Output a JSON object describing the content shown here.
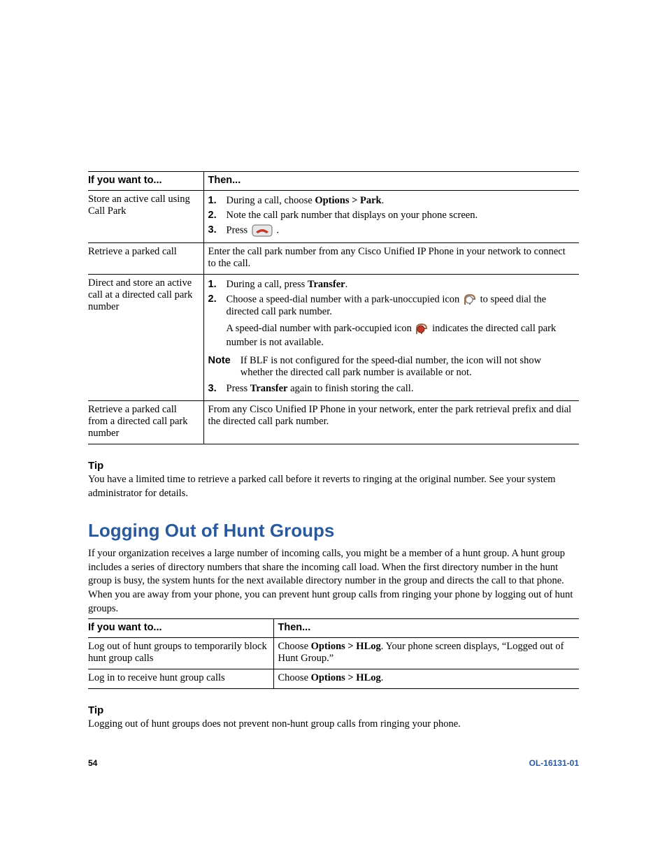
{
  "table1": {
    "head": {
      "c1": "If you want to...",
      "c2": "Then..."
    },
    "rows": [
      {
        "c1": "Store an active call using Call Park",
        "steps": [
          {
            "n": "1.",
            "pre": "During a call, choose ",
            "bold": "Options > Park",
            "post": "."
          },
          {
            "n": "2.",
            "text": "Note the call park number that displays on your phone screen."
          },
          {
            "n": "3.",
            "pre": "Press ",
            "icon": "endcall",
            "post": " ."
          }
        ]
      },
      {
        "c1": "Retrieve a parked call",
        "plain": "Enter the call park number from any Cisco Unified IP Phone in your network to connect to the call."
      },
      {
        "c1": "Direct and store an active call at a directed call park number",
        "steps": [
          {
            "n": "1.",
            "pre": "During a call, press ",
            "bold": "Transfer",
            "post": "."
          },
          {
            "n": "2.",
            "text_parts": [
              "Choose a speed-dial number with a park-unoccupied icon ",
              " to speed dial the directed call park number."
            ],
            "icon": "park-empty"
          }
        ],
        "sub": {
          "pre": "A speed-dial number with park-occupied icon ",
          "icon": "park-full",
          "post": " indicates the directed call park number is not available."
        },
        "note": {
          "label": "Note",
          "text": "If BLF is not configured for the speed-dial number, the icon will not show whether the directed call park number is available or not."
        },
        "steps2": [
          {
            "n": "3.",
            "pre": "Press ",
            "bold": "Transfer",
            "post": " again to finish storing the call."
          }
        ]
      },
      {
        "c1": "Retrieve a parked call from a directed call park number",
        "plain": "From any Cisco Unified IP Phone in your network, enter the park retrieval prefix and dial the directed call park number."
      }
    ]
  },
  "tip1": {
    "label": "Tip",
    "text": "You have a limited time to retrieve a parked call before it reverts to ringing at the original number. See your system administrator for details."
  },
  "section_title": "Logging Out of Hunt Groups",
  "section_intro": "If your organization receives a large number of incoming calls, you might be a member of a hunt group. A hunt group includes a series of directory numbers that share the incoming call load. When the first directory number in the hunt group is busy, the system hunts for the next available directory number in the group and directs the call to that phone. When you are away from your phone, you can prevent hunt group calls from ringing your phone by logging out of hunt groups.",
  "table2": {
    "head": {
      "c1": "If you want to...",
      "c2": "Then..."
    },
    "rows": [
      {
        "c1": "Log out of hunt groups to temporarily block hunt group calls",
        "pre": "Choose ",
        "bold": "Options > HLog",
        "post": ". Your phone screen displays, “Logged out of Hunt Group.”"
      },
      {
        "c1": "Log in to receive hunt group calls",
        "pre": "Choose ",
        "bold": "Options > HLog",
        "post": "."
      }
    ]
  },
  "tip2": {
    "label": "Tip",
    "text": "Logging out of hunt groups does not prevent non-hunt group calls from ringing your phone."
  },
  "footer": {
    "page": "54",
    "doc": "OL-16131-01"
  }
}
